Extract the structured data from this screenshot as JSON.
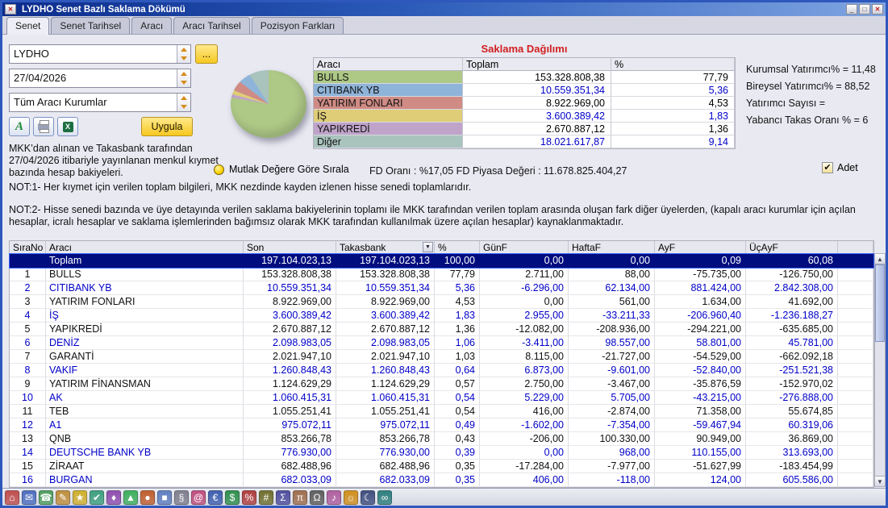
{
  "window": {
    "title": "LYDHO Senet Bazlı Saklama Dökümü"
  },
  "tabs": [
    "Senet",
    "Senet Tarihsel",
    "Aracı",
    "Aracı Tarihsel",
    "Pozisyon Farkları"
  ],
  "filters": {
    "symbol": "LYDHO",
    "date": "27/04/2026",
    "broker": "Tüm Aracı Kurumlar",
    "more_button": "...",
    "apply": "Uygula"
  },
  "info_text": "MKK’dan alınan ve Takasbank tarafından 27/04/2026 itibariyle yayınlanan menkul kıymet bazında hesap bakiyeleri.",
  "distribution": {
    "title": "Saklama Dağılımı",
    "columns": [
      "Aracı",
      "Toplam",
      "%"
    ],
    "rows": [
      {
        "name": "BULLS",
        "total": "153.328.808,38",
        "pct": "77,79",
        "color": "#aec886"
      },
      {
        "name": "CITIBANK YB",
        "total": "10.559.351,34",
        "pct": "5,36",
        "color": "#8fb4d9"
      },
      {
        "name": "YATIRIM FONLARI",
        "total": "8.922.969,00",
        "pct": "4,53",
        "color": "#cf8b84"
      },
      {
        "name": "İŞ",
        "total": "3.600.389,42",
        "pct": "1,83",
        "color": "#dfcd78"
      },
      {
        "name": "YAPIKREDİ",
        "total": "2.670.887,12",
        "pct": "1,36",
        "color": "#bfa3c9"
      },
      {
        "name": "Diğer",
        "total": "18.021.617,87",
        "pct": "9,14",
        "color": "#a9c3bd"
      }
    ]
  },
  "chart_data": {
    "type": "pie",
    "title": "Saklama Dağılımı",
    "labels": [
      "BULLS",
      "CITIBANK YB",
      "YATIRIM FONLARI",
      "İŞ",
      "YAPIKREDİ",
      "Diğer"
    ],
    "values": [
      77.79,
      5.36,
      4.53,
      1.83,
      1.36,
      9.14
    ],
    "totals": [
      "153.328.808,38",
      "10.559.351,34",
      "8.922.969,00",
      "3.600.389,42",
      "2.670.887,12",
      "18.021.617,87"
    ]
  },
  "stats": [
    "Kurumsal Yatırımcı% = 11,48",
    "Bireysel Yatırımcı% = 88,52",
    "Yatırımcı Sayısı =",
    "Yabancı Takas Oranı % = 6"
  ],
  "sort_option": "Mutlak Değere Göre Sırala",
  "fd_line": "FD Oranı : %17,05 FD Piyasa Değeri : 11.678.825.404,27",
  "adet": {
    "label": "Adet",
    "checked": true,
    "check_glyph": "✔"
  },
  "notes": [
    "NOT:1- Her kıymet için verilen toplam bilgileri, MKK nezdinde kayden izlenen hisse senedi toplamlarıdır.",
    "NOT:2- Hisse senedi bazında ve üye detayında verilen saklama bakiyelerinin toplamı ile MKK tarafından verilen toplam arasında oluşan fark diğer üyelerden, (kapalı aracı kurumlar için açılan hesaplar, icralı hesaplar ve saklama işlemlerinden bağımsız olarak MKK tarafından kullanılmak üzere açılan hesaplar) kaynaklanmaktadır."
  ],
  "main_table": {
    "columns": [
      "SıraNo",
      "Aracı",
      "Son",
      "Takasbank",
      "%",
      "GünF",
      "HaftaF",
      "AyF",
      "ÜçAyF"
    ],
    "total_row": [
      "",
      "Toplam",
      "197.104.023,13",
      "197.104.023,13",
      "100,00",
      "0,00",
      "0,00",
      "0,09",
      "60,08"
    ],
    "rows": [
      [
        "1",
        "BULLS",
        "153.328.808,38",
        "153.328.808,38",
        "77,79",
        "2.711,00",
        "88,00",
        "-75.735,00",
        "-126.750,00"
      ],
      [
        "2",
        "CITIBANK YB",
        "10.559.351,34",
        "10.559.351,34",
        "5,36",
        "-6.296,00",
        "62.134,00",
        "881.424,00",
        "2.842.308,00"
      ],
      [
        "3",
        "YATIRIM FONLARI",
        "8.922.969,00",
        "8.922.969,00",
        "4,53",
        "0,00",
        "561,00",
        "1.634,00",
        "41.692,00"
      ],
      [
        "4",
        "İŞ",
        "3.600.389,42",
        "3.600.389,42",
        "1,83",
        "2.955,00",
        "-33.211,33",
        "-206.960,40",
        "-1.236.188,27"
      ],
      [
        "5",
        "YAPIKREDİ",
        "2.670.887,12",
        "2.670.887,12",
        "1,36",
        "-12.082,00",
        "-208.936,00",
        "-294.221,00",
        "-635.685,00"
      ],
      [
        "6",
        "DENİZ",
        "2.098.983,05",
        "2.098.983,05",
        "1,06",
        "-3.411,00",
        "98.557,00",
        "58.801,00",
        "45.781,00"
      ],
      [
        "7",
        "GARANTİ",
        "2.021.947,10",
        "2.021.947,10",
        "1,03",
        "8.115,00",
        "-21.727,00",
        "-54.529,00",
        "-662.092,18"
      ],
      [
        "8",
        "VAKIF",
        "1.260.848,43",
        "1.260.848,43",
        "0,64",
        "6.873,00",
        "-9.601,00",
        "-52.840,00",
        "-251.521,38"
      ],
      [
        "9",
        "YATIRIM FİNANSMAN",
        "1.124.629,29",
        "1.124.629,29",
        "0,57",
        "2.750,00",
        "-3.467,00",
        "-35.876,59",
        "-152.970,02"
      ],
      [
        "10",
        "AK",
        "1.060.415,31",
        "1.060.415,31",
        "0,54",
        "5.229,00",
        "5.705,00",
        "-43.215,00",
        "-276.888,00"
      ],
      [
        "11",
        "TEB",
        "1.055.251,41",
        "1.055.251,41",
        "0,54",
        "416,00",
        "-2.874,00",
        "71.358,00",
        "55.674,85"
      ],
      [
        "12",
        "A1",
        "975.072,11",
        "975.072,11",
        "0,49",
        "-1.602,00",
        "-7.354,00",
        "-59.467,94",
        "60.319,06"
      ],
      [
        "13",
        "QNB",
        "853.266,78",
        "853.266,78",
        "0,43",
        "-206,00",
        "100.330,00",
        "90.949,00",
        "36.869,00"
      ],
      [
        "14",
        "DEUTSCHE BANK YB",
        "776.930,00",
        "776.930,00",
        "0,39",
        "0,00",
        "968,00",
        "110.155,00",
        "313.693,00"
      ],
      [
        "15",
        "ZİRAAT",
        "682.488,96",
        "682.488,96",
        "0,35",
        "-17.284,00",
        "-7.977,00",
        "-51.627,99",
        "-183.454,99"
      ],
      [
        "16",
        "BURGAN",
        "682.033,09",
        "682.033,09",
        "0,35",
        "406,00",
        "-118,00",
        "124,00",
        "605.586,00"
      ]
    ]
  },
  "taskbar": {
    "icons": [
      {
        "name": "home-icon",
        "glyph": "⌂",
        "color": "#c05050"
      },
      {
        "name": "mail-icon",
        "glyph": "✉",
        "color": "#5070c0"
      },
      {
        "name": "phone-icon",
        "glyph": "☎",
        "color": "#50a060"
      },
      {
        "name": "edit-icon",
        "glyph": "✎",
        "color": "#c09040"
      },
      {
        "name": "favorites-icon",
        "glyph": "★",
        "color": "#d0b030"
      },
      {
        "name": "tasks-icon",
        "glyph": "✔",
        "color": "#40a080"
      },
      {
        "name": "portfolio-icon",
        "glyph": "♦",
        "color": "#9050b0"
      },
      {
        "name": "chart-up-icon",
        "glyph": "▲",
        "color": "#40b060"
      },
      {
        "name": "market-icon",
        "glyph": "●",
        "color": "#c06030"
      },
      {
        "name": "grid-icon",
        "glyph": "■",
        "color": "#6080c0"
      },
      {
        "name": "news-icon",
        "glyph": "§",
        "color": "#808090"
      },
      {
        "name": "contacts-icon",
        "glyph": "@",
        "color": "#c05080"
      },
      {
        "name": "euro-icon",
        "glyph": "€",
        "color": "#4060b0"
      },
      {
        "name": "dollar-icon",
        "glyph": "$",
        "color": "#309050"
      },
      {
        "name": "percent-icon",
        "glyph": "%",
        "color": "#b04040"
      },
      {
        "name": "hash-icon",
        "glyph": "#",
        "color": "#707030"
      },
      {
        "name": "sum-icon",
        "glyph": "Σ",
        "color": "#5050a0"
      },
      {
        "name": "pi-icon",
        "glyph": "π",
        "color": "#a07050"
      },
      {
        "name": "omega-icon",
        "glyph": "Ω",
        "color": "#606060"
      },
      {
        "name": "music-icon",
        "glyph": "♪",
        "color": "#b060a0"
      },
      {
        "name": "sun-icon",
        "glyph": "☼",
        "color": "#d09020"
      },
      {
        "name": "moon-icon",
        "glyph": "☾",
        "color": "#405080"
      },
      {
        "name": "infinity-icon",
        "glyph": "∞",
        "color": "#308080"
      }
    ]
  }
}
